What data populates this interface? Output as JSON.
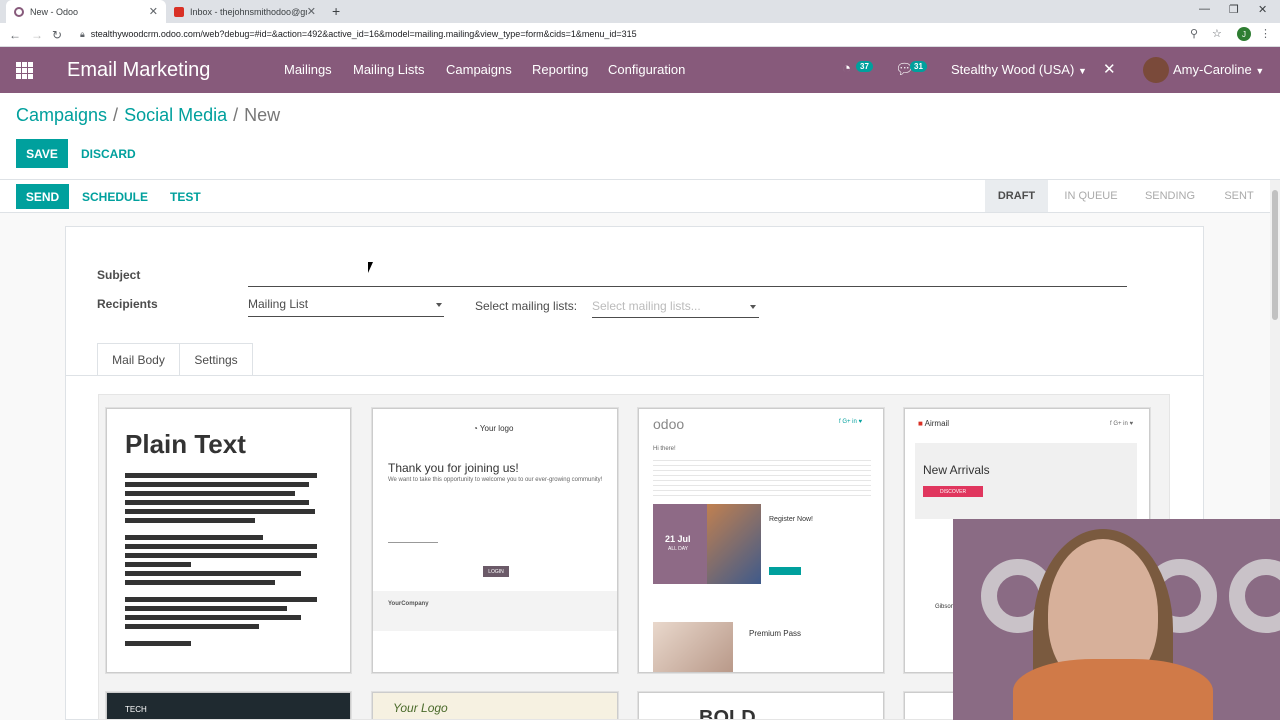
{
  "browser": {
    "tabs": [
      {
        "title": "New - Odoo",
        "active": true
      },
      {
        "title": "Inbox - thejohnsmithodoo@gma",
        "active": false
      }
    ],
    "url": "stealthywoodcrm.odoo.com/web?debug=#id=&action=492&active_id=16&model=mailing.mailing&view_type=form&cids=1&menu_id=315",
    "profile_initial": "J"
  },
  "navbar": {
    "app_name": "Email Marketing",
    "menu": [
      "Mailings",
      "Mailing Lists",
      "Campaigns",
      "Reporting",
      "Configuration"
    ],
    "activity_count": "37",
    "message_count": "31",
    "company": "Stealthy Wood (USA)",
    "user": "Amy-Caroline"
  },
  "breadcrumb": {
    "items": [
      "Campaigns",
      "Social Media"
    ],
    "current": "New"
  },
  "buttons": {
    "save": "SAVE",
    "discard": "DISCARD",
    "send": "SEND",
    "schedule": "SCHEDULE",
    "test": "TEST"
  },
  "stages": [
    "DRAFT",
    "IN QUEUE",
    "SENDING",
    "SENT"
  ],
  "form": {
    "subject_label": "Subject",
    "subject_value": "",
    "recipients_label": "Recipients",
    "recipients_value": "Mailing List",
    "mailing_lists_label": "Select mailing lists:",
    "mailing_lists_placeholder": "Select mailing lists..."
  },
  "notebook": {
    "tabs": [
      "Mail Body",
      "Settings"
    ]
  },
  "templates": {
    "plain_text": "Plain Text",
    "welcome_logo": "Your logo",
    "welcome_heading": "Thank you for joining us!",
    "welcome_body": "We want to take this opportunity to welcome you to our ever-growing community!",
    "welcome_login": "LOGIN",
    "welcome_company": "YourCompany",
    "event_logo": "odoo",
    "event_hi": "Hi there!",
    "event_date": "21 Jul",
    "event_allday": "ALL DAY",
    "event_register": "Register Now!",
    "event_premium": "Premium Pass",
    "airmail_logo": "Airmail",
    "airmail_heading": "New Arrivals",
    "airmail_discover": "DISCOVER",
    "airmail_gibson": "Gibson",
    "tech_logo": "TECH",
    "yourlogo2": "Your Logo",
    "bold": "BOLD"
  }
}
